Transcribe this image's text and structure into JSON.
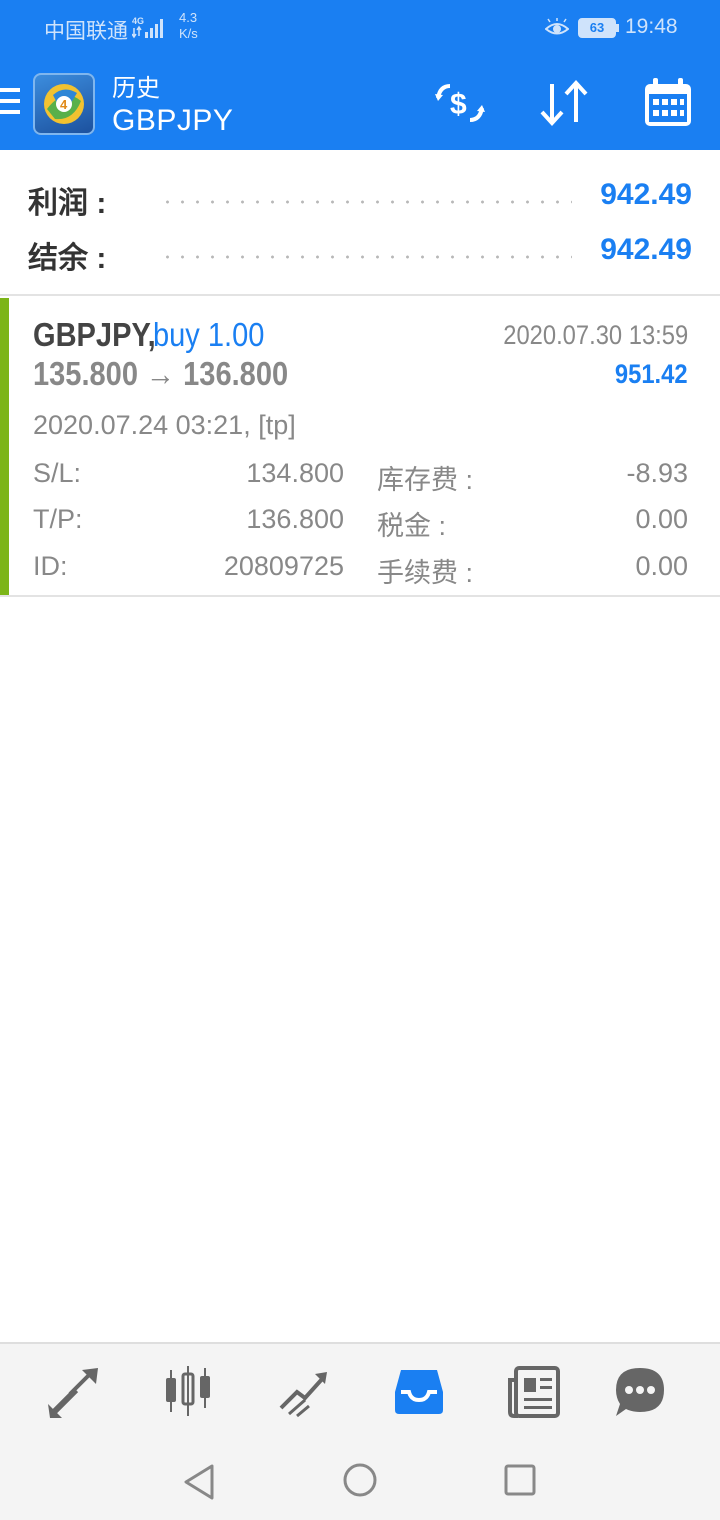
{
  "status_bar": {
    "carrier": "中国联通",
    "net_type": "4G",
    "speed_value": "4.3",
    "speed_unit": "K/s",
    "battery": "63",
    "time": "19:48"
  },
  "app_bar": {
    "title": "历史",
    "subtitle": "GBPJPY",
    "icons": [
      "menu-icon",
      "metatrader-logo",
      "currency-exchange-icon",
      "sort-icon",
      "calendar-icon"
    ]
  },
  "summary": {
    "profit_label": "利润 :",
    "profit_value": "942.49",
    "balance_label": "结余 :",
    "balance_value": "942.49"
  },
  "deal": {
    "symbol": "GBPJPY,",
    "type": "buy 1.00",
    "close_time": "2020.07.30 13:59",
    "prices": "135.800 → 136.800",
    "profit": "951.42",
    "open_time": "2020.07.24 03:21, [tp]",
    "sl_label": "S/L:",
    "sl_value": "134.800",
    "tp_label": "T/P:",
    "tp_value": "136.800",
    "id_label": "ID:",
    "id_value": "20809725",
    "swap_label": "库存费 :",
    "swap_value": "-8.93",
    "tax_label": "税金 :",
    "tax_value": "0.00",
    "commission_label": "手续费 :",
    "commission_value": "0.00",
    "accent_color": "#7cb518"
  },
  "bottom_nav": {
    "items": [
      "quotes-icon",
      "chart-icon",
      "trade-icon",
      "history-icon",
      "news-icon",
      "chat-icon"
    ],
    "active": "history-icon"
  },
  "colors": {
    "primary": "#1a7ff2",
    "profit": "#1a7ff2",
    "buy_bar": "#7cb518"
  }
}
